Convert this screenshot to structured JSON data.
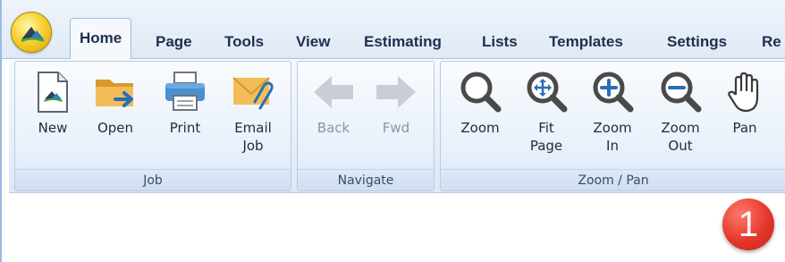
{
  "tabs": [
    "Home",
    "Page",
    "Tools",
    "View",
    "Estimating",
    "Lists",
    "Templates",
    "Settings",
    "Re"
  ],
  "groups": {
    "job": {
      "caption": "Job",
      "buttons": {
        "new": "New",
        "open": "Open",
        "print": "Print",
        "email": "Email\nJob"
      }
    },
    "navigate": {
      "caption": "Navigate",
      "buttons": {
        "back": "Back",
        "fwd": "Fwd"
      }
    },
    "zoom_pan": {
      "caption": "Zoom / Pan",
      "buttons": {
        "zoom": "Zoom",
        "fit_page": "Fit\nPage",
        "zoom_in": "Zoom\nIn",
        "zoom_out": "Zoom\nOut",
        "pan": "Pan"
      }
    }
  },
  "badge": "1",
  "colors": {
    "accent": "#2a6fb5",
    "badge": "#e4372b",
    "folder": "#e6ad40",
    "magnifier": "#4a4a4a"
  }
}
